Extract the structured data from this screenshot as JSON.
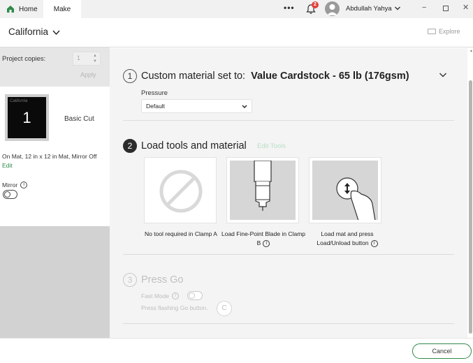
{
  "titlebar": {
    "tabs": [
      {
        "label": "Home"
      },
      {
        "label": "Make"
      }
    ],
    "more_label": "•••",
    "notification_count": "2",
    "user_name": "Abdullah Yahya",
    "min_glyph": "−",
    "close_glyph": "✕"
  },
  "header": {
    "machine_name": "California",
    "explore_label": "Explore"
  },
  "left_panel": {
    "copies_label": "Project copies:",
    "copies_value": "1",
    "apply_label": "Apply",
    "mat_number": "1",
    "mat_scribble": "California",
    "cut_type": "Basic Cut",
    "mat_info": "On Mat, 12 in x 12 in Mat, Mirror Off",
    "edit_label": "Edit",
    "mirror_label": "Mirror"
  },
  "steps": {
    "step1": {
      "number": "1",
      "title_prefix": "Custom material set to:",
      "material": "Value Cardstock - 65 lb (176gsm)",
      "pressure_label": "Pressure",
      "pressure_value": "Default"
    },
    "step2": {
      "number": "2",
      "title": "Load tools and material",
      "edit_tools_label": "Edit Tools",
      "cards": [
        {
          "caption": "No tool required in Clamp A"
        },
        {
          "caption": "Load Fine-Point Blade in Clamp B"
        },
        {
          "caption": "Load mat and press Load/Unload button"
        }
      ]
    },
    "step3": {
      "number": "3",
      "title": "Press Go",
      "fast_mode_label": "Fast Mode",
      "press_go_label": "Press flashing Go button.",
      "go_glyph": "C"
    }
  },
  "footer": {
    "cancel_label": "Cancel"
  },
  "info_glyph": "i",
  "colors": {
    "accent_green": "#2f8a4a",
    "badge_red": "#e2413d",
    "disabled_gray": "#c0c0c0"
  }
}
